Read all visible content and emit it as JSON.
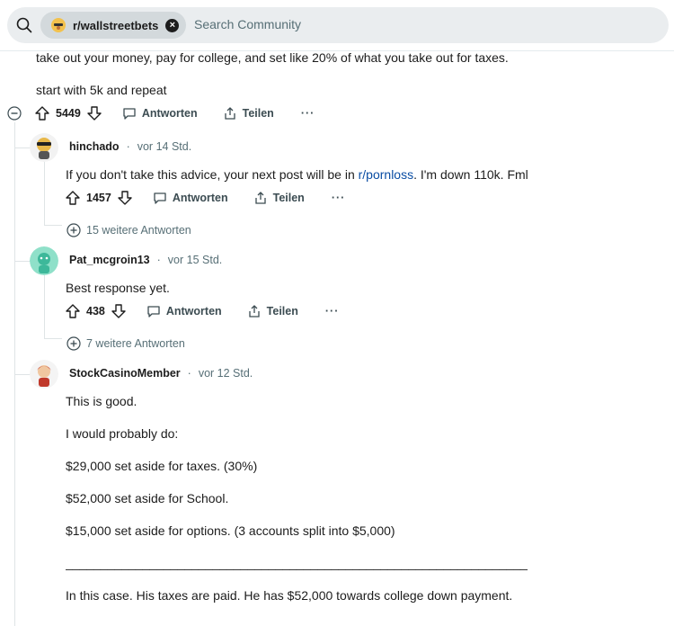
{
  "search": {
    "community_chip": "r/wallstreetbets",
    "placeholder": "Search Community"
  },
  "parent": {
    "line1": "take out your money, pay for college, and set like 20% of what you take out for taxes.",
    "line2": "start with 5k and repeat",
    "score": "5449",
    "reply": "Antworten",
    "share": "Teilen",
    "more": "···"
  },
  "comments": [
    {
      "author": "hinchado",
      "dot": "·",
      "time": "vor 14 Std.",
      "body_pre": "If you don't take this advice, your next post will be in ",
      "body_link": "r/pornloss",
      "body_post": ". I'm down 110k. Fml",
      "score": "1457",
      "reply": "Antworten",
      "share": "Teilen",
      "more": "···",
      "more_replies": "15 weitere Antworten"
    },
    {
      "author": "Pat_mcgroin13",
      "dot": "·",
      "time": "vor 15 Std.",
      "body": "Best response yet.",
      "score": "438",
      "reply": "Antworten",
      "share": "Teilen",
      "more": "···",
      "more_replies": "7 weitere Antworten"
    },
    {
      "author": "StockCasinoMember",
      "dot": "·",
      "time": "vor 12 Std.",
      "paragraphs": [
        "This is good.",
        "I would probably do:",
        "$29,000 set aside for taxes. (30%)",
        "$52,000 set aside for School.",
        "$15,000 set aside for options. (3 accounts split into $5,000)",
        "__________________________________________________________________",
        "In this case. His taxes are paid. He has $52,000 towards college down payment."
      ]
    }
  ],
  "colors": {
    "accent_link": "#0a4da3",
    "thread_line": "#dfe4e6",
    "search_bg": "#eaedef"
  }
}
